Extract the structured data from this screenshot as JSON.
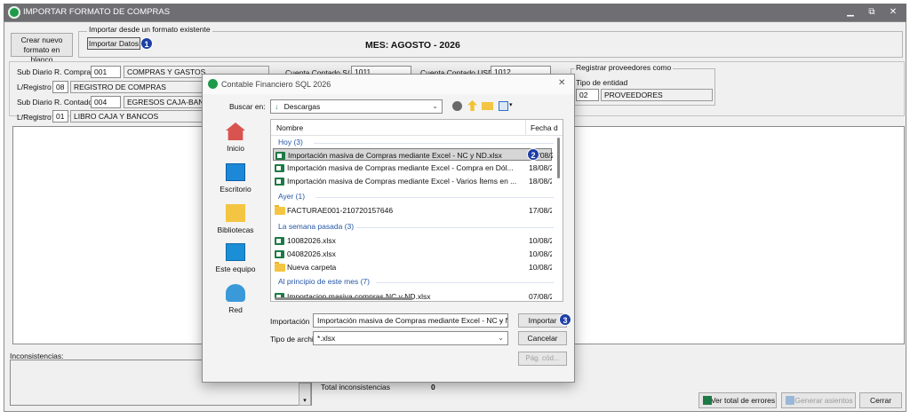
{
  "window": {
    "title": "IMPORTAR FORMATO DE COMPRAS",
    "min": "▁",
    "restore": "⧉",
    "close": "✕"
  },
  "toolbar": {
    "create_label_1": "Crear nuevo",
    "create_label_2": "formato en blanco",
    "import_group_label": "Importar desde un formato existente",
    "import_button_label": "Importar Datos",
    "step1": "1",
    "month_label": "MES: AGOSTO - 2026"
  },
  "form": {
    "subdiario_compra_label": "Sub Diario R. Compra",
    "subdiario_compra_code": "001",
    "subdiario_compra_name": "COMPRAS Y GASTOS",
    "lregistro1_label": "L/Registro",
    "lregistro1_code": "08",
    "lregistro1_name": "REGISTRO DE COMPRAS",
    "subdiario_contado_label": "Sub Diario R. Contado",
    "subdiario_contado_code": "004",
    "subdiario_contado_name": "EGRESOS CAJA-BANC",
    "lregistro2_label": "L/Registro",
    "lregistro2_code": "01",
    "lregistro2_name": "LIBRO CAJA Y BANCOS",
    "cuenta_soles_label": "Cuenta Contado S/.",
    "cuenta_soles_value": "1011",
    "cuenta_usd_label": "Cuenta Contado USD",
    "cuenta_usd_value": "1012",
    "registrar_group_label": "Registrar proveedores como",
    "tipo_entidad_label": "Tipo de entidad",
    "tipo_entidad_code": "02",
    "tipo_entidad_name": "PROVEEDORES"
  },
  "bottom": {
    "inconsistencias_label": "Inconsistencias:",
    "total_label": "Total inconsistencias",
    "total_value": "0",
    "ver_errores_label": "Ver total de errores",
    "generar_label": "Generar asientos",
    "cerrar_label": "Cerrar"
  },
  "dialog": {
    "title": "Contable Financiero SQL 2026",
    "close": "✕",
    "buscar_label": "Buscar en:",
    "buscar_value": "Descargas",
    "nav": [
      {
        "label": "Inicio"
      },
      {
        "label": "Escritorio"
      },
      {
        "label": "Bibliotecas"
      },
      {
        "label": "Este equipo"
      },
      {
        "label": "Red"
      }
    ],
    "col_name": "Nombre",
    "col_date": "Fecha d",
    "groups": {
      "hoy": "Hoy (3)",
      "ayer": "Ayer (1)",
      "semana": "La semana pasada (3)",
      "principio": "Al principio de este mes (7)"
    },
    "files": {
      "f1_name": "Importación masiva de Compras mediante Excel - NC y ND.xlsx",
      "f1_date": "18/08/2",
      "f2_name": "Importación masiva de Compras mediante Excel - Compra en Dól...",
      "f2_date": "18/08/2",
      "f3_name": "Importación masiva de Compras mediante Excel - Varios Ítems en ...",
      "f3_date": "18/08/2",
      "f4_name": "FACTURAE001-210720157646",
      "f4_date": "17/08/2",
      "f5_name": "10082026.xlsx",
      "f5_date": "10/08/2",
      "f6_name": "04082026.xlsx",
      "f6_date": "10/08/2",
      "f7_name": "Nueva carpeta",
      "f7_date": "10/08/2",
      "f8_name": "Importacion masiva compras NC y ND.xlsx",
      "f8_date": "07/08/2"
    },
    "step2": "2",
    "filename_label": "Importación",
    "filename_value": "Importación masiva de Compras mediante Excel - NC y N",
    "filetype_label": "Tipo de archiv",
    "filetype_value": "*.xlsx",
    "import_button": "Importar",
    "step3": "3",
    "cancel_button": "Cancelar",
    "help_button": "Pág. cód..."
  }
}
